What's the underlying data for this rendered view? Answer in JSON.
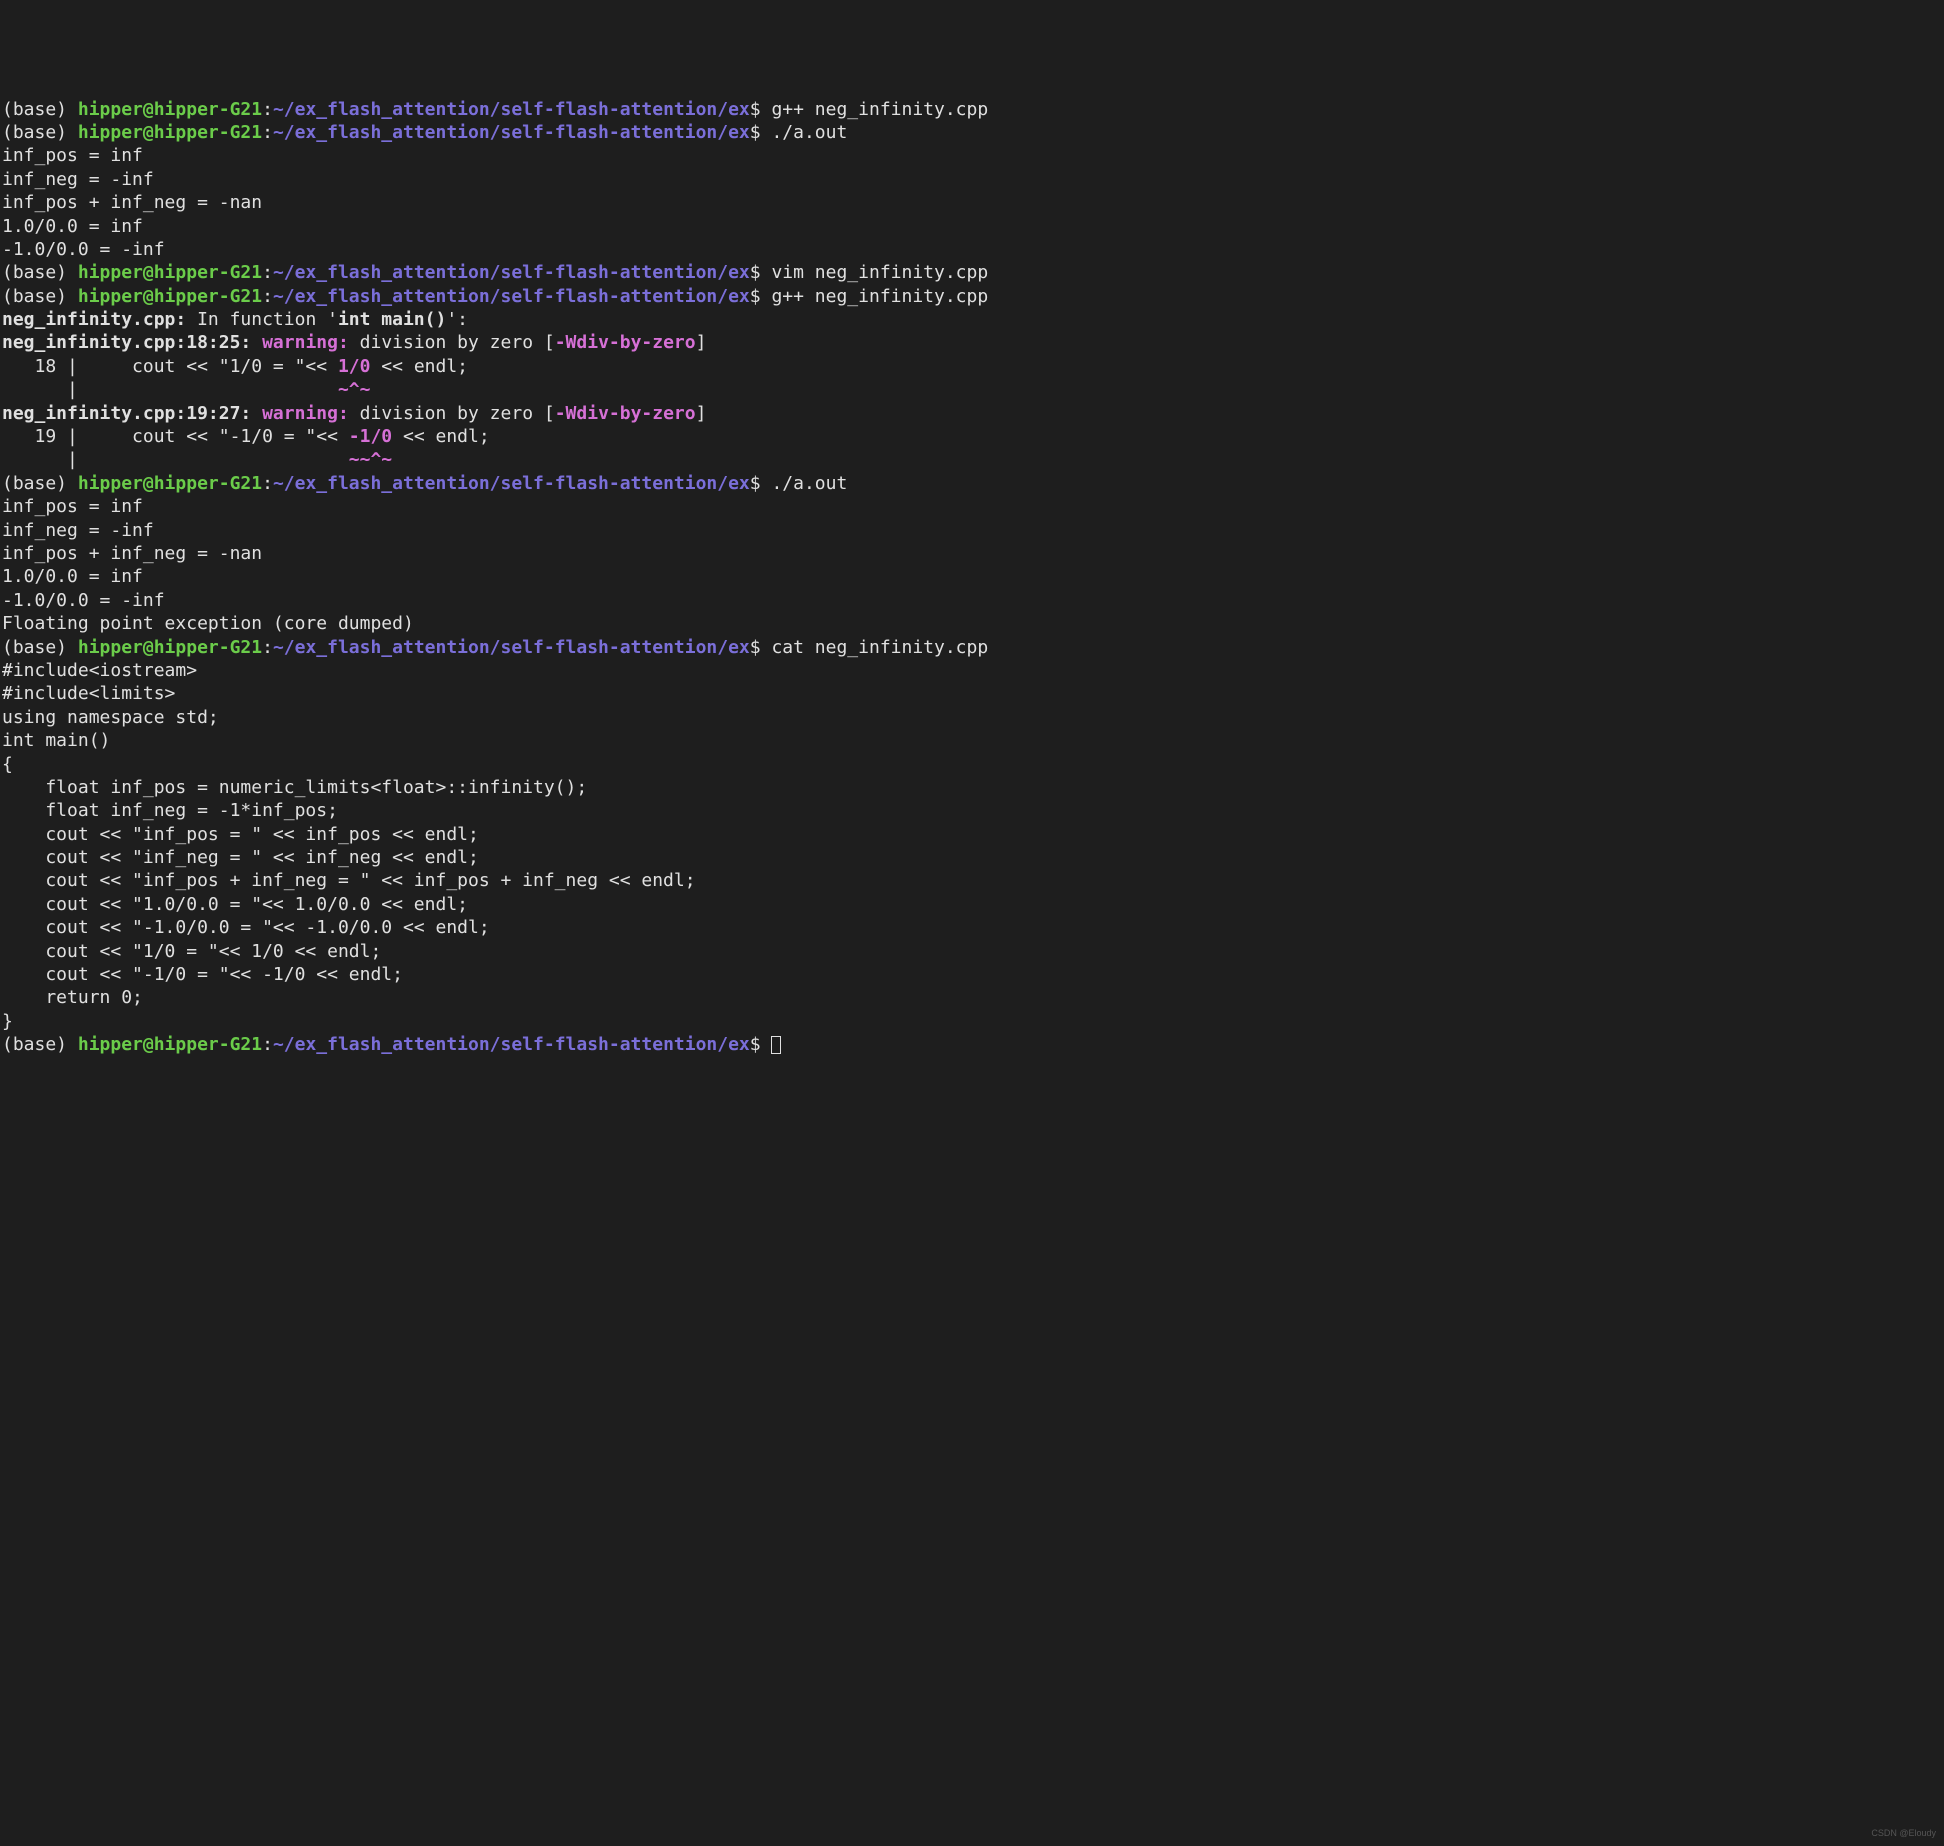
{
  "prompt": {
    "base": "(base) ",
    "user": "hipper@hipper-G21",
    "colon": ":",
    "path": "~/ex_flash_attention/self-flash-attention/ex",
    "dollar": "$ "
  },
  "commands": {
    "gpp1": "g++ neg_infinity.cpp",
    "run1": "./a.out",
    "vim": "vim neg_infinity.cpp",
    "gpp2": "g++ neg_infinity.cpp",
    "run2": "./a.out",
    "cat": "cat neg_infinity.cpp"
  },
  "output1": {
    "l1": "inf_pos = inf",
    "l2": "inf_neg = -inf",
    "l3": "inf_pos + inf_neg = -nan",
    "l4": "1.0/0.0 = inf",
    "l5": "-1.0/0.0 = -inf"
  },
  "warn": {
    "file_func": "neg_infinity.cpp:",
    "in_func": " In function '",
    "func_name": "int main()",
    "close": "':",
    "loc1": "neg_infinity.cpp:18:25: ",
    "loc2": "neg_infinity.cpp:19:27: ",
    "warning_label": "warning: ",
    "msg": "division by zero [",
    "flag": "-Wdiv-by-zero",
    "bracket": "]",
    "line18_pre": "   18 |     cout << \"1/0 = \"<< ",
    "line18_hl": "1/0",
    "line18_post": " << endl;",
    "caret18_pre": "      |                        ",
    "caret18": "~^~",
    "line19_pre": "   19 |     cout << \"-1/0 = \"<< ",
    "line19_hl": "-1/0",
    "line19_post": " << endl;",
    "caret19_pre": "      |                         ",
    "caret19": "~~^~"
  },
  "output2": {
    "l1": "inf_pos = inf",
    "l2": "inf_neg = -inf",
    "l3": "inf_pos + inf_neg = -nan",
    "l4": "1.0/0.0 = inf",
    "l5": "-1.0/0.0 = -inf",
    "l6": "Floating point exception (core dumped)"
  },
  "source": {
    "l1": "#include<iostream>",
    "l2": "#include<limits>",
    "l3": "",
    "l4": "using namespace std;",
    "l5": "",
    "l6": "int main()",
    "l7": "{",
    "l8": "    float inf_pos = numeric_limits<float>::infinity();",
    "l9": "",
    "l10": "    float inf_neg = -1*inf_pos;",
    "l11": "",
    "l12": "    cout << \"inf_pos = \" << inf_pos << endl;",
    "l13": "    cout << \"inf_neg = \" << inf_neg << endl;",
    "l14": "    cout << \"inf_pos + inf_neg = \" << inf_pos + inf_neg << endl;",
    "l15": "    cout << \"1.0/0.0 = \"<< 1.0/0.0 << endl;",
    "l16": "    cout << \"-1.0/0.0 = \"<< -1.0/0.0 << endl;",
    "l17": "",
    "l18": "    cout << \"1/0 = \"<< 1/0 << endl;",
    "l19": "    cout << \"-1/0 = \"<< -1/0 << endl;",
    "l20": "    return 0;",
    "l21": "}"
  },
  "watermark": "CSDN @Eloudy"
}
